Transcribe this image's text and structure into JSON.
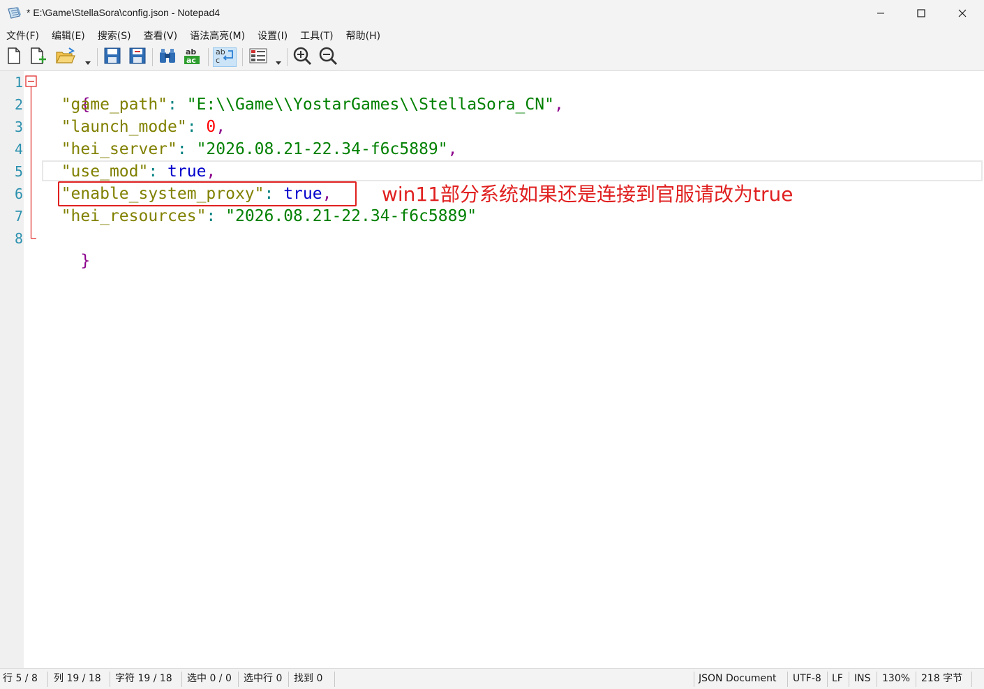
{
  "window": {
    "title": "* E:\\Game\\StellaSora\\config.json - Notepad4",
    "controls": {
      "minimize": "minimize-icon",
      "maximize": "maximize-icon",
      "close": "close-icon"
    }
  },
  "menu": {
    "items": [
      {
        "label": "文件(F)"
      },
      {
        "label": "编辑(E)"
      },
      {
        "label": "搜索(S)"
      },
      {
        "label": "查看(V)"
      },
      {
        "label": "语法高亮(M)"
      },
      {
        "label": "设置(I)"
      },
      {
        "label": "工具(T)"
      },
      {
        "label": "帮助(H)"
      }
    ]
  },
  "toolbar": {
    "buttons": [
      "new-file-icon",
      "new-window-icon",
      "open-folder-icon",
      "save-icon",
      "save-as-icon",
      "find-icon",
      "replace-icon",
      "word-wrap-icon",
      "scheme-icon",
      "zoom-in-icon",
      "zoom-out-icon"
    ]
  },
  "editor": {
    "line_numbers": [
      "1",
      "2",
      "3",
      "4",
      "5",
      "6",
      "7",
      "8"
    ],
    "lines": [
      {
        "indent": "",
        "key": "",
        "colon": "",
        "value": "",
        "comma": "",
        "open": "{"
      },
      {
        "indent": "  ",
        "key": "\"game_path\"",
        "colon": ": ",
        "value": "\"E:\\\\Game\\\\YostarGames\\\\StellaSora_CN\"",
        "comma": ","
      },
      {
        "indent": "  ",
        "key": "\"launch_mode\"",
        "colon": ": ",
        "value": "0",
        "comma": ","
      },
      {
        "indent": "  ",
        "key": "\"hei_server\"",
        "colon": ": ",
        "value": "\"2026.08.21-22.34-f6c5889\"",
        "comma": ","
      },
      {
        "indent": "  ",
        "key": "\"use_mod\"",
        "colon": ": ",
        "value": "true",
        "comma": ","
      },
      {
        "indent": "  ",
        "key": "\"enable_system_proxy\"",
        "colon": ": ",
        "value": "true",
        "comma": ","
      },
      {
        "indent": "  ",
        "key": "\"hei_resources\"",
        "colon": ": ",
        "value": "\"2026.08.21-22.34-f6c5889\"",
        "comma": ""
      },
      {
        "indent": "",
        "key": "",
        "colon": "",
        "value": "",
        "comma": "",
        "close": "}"
      }
    ],
    "annotation": "win11部分系统如果还是连接到官服请改为true",
    "annotation_color": "#e02020"
  },
  "status": {
    "line": "行 5 / 8",
    "column": "列 19 / 18",
    "char": "字符 19 / 18",
    "selection": "选中 0 / 0",
    "selected_lines": "选中行 0",
    "found": "找到 0",
    "doc_type": "JSON Document",
    "encoding": "UTF-8",
    "eol": "LF",
    "mode": "INS",
    "zoom": "130%",
    "size": "218 字节"
  },
  "colors": {
    "line_number": "#2b91af",
    "key": "#808000",
    "string": "#008000",
    "number": "#ff0000",
    "boolean": "#0000cc",
    "brace": "#8b008b"
  }
}
